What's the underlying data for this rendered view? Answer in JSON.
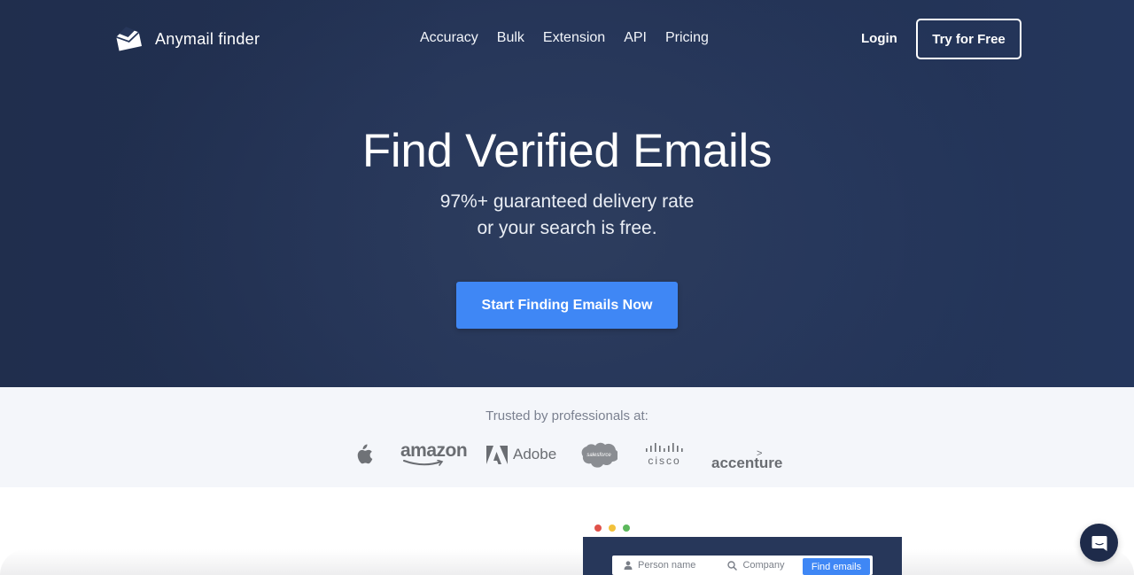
{
  "nav": {
    "brand": "Anymail finder",
    "links": [
      "Accuracy",
      "Bulk",
      "Extension",
      "API",
      "Pricing"
    ],
    "login": "Login",
    "try_free": "Try for Free"
  },
  "hero": {
    "title": "Find Verified Emails",
    "subtitle_line1": "97%+ guaranteed delivery rate",
    "subtitle_line2": "or your search is free.",
    "cta": "Start Finding Emails Now"
  },
  "trusted": {
    "label": "Trusted by professionals at:",
    "brands": {
      "apple": "apple-logo",
      "amazon": "amazon",
      "adobe": "Adobe",
      "salesforce": "salesforce",
      "cisco": "cisco",
      "accenture": "accenture"
    }
  },
  "demo": {
    "window_dots": [
      "#e0524a",
      "#f2c13b",
      "#5cb85c"
    ],
    "person_placeholder": "Person name",
    "company_placeholder": "Company",
    "find_button": "Find emails"
  },
  "chat": {
    "icon": "chat-icon"
  },
  "colors": {
    "hero_bg": "#27375a",
    "accent": "#3f87f5",
    "trusted_bg": "#f4f6fa",
    "chat_bg": "#1e2b4a"
  }
}
